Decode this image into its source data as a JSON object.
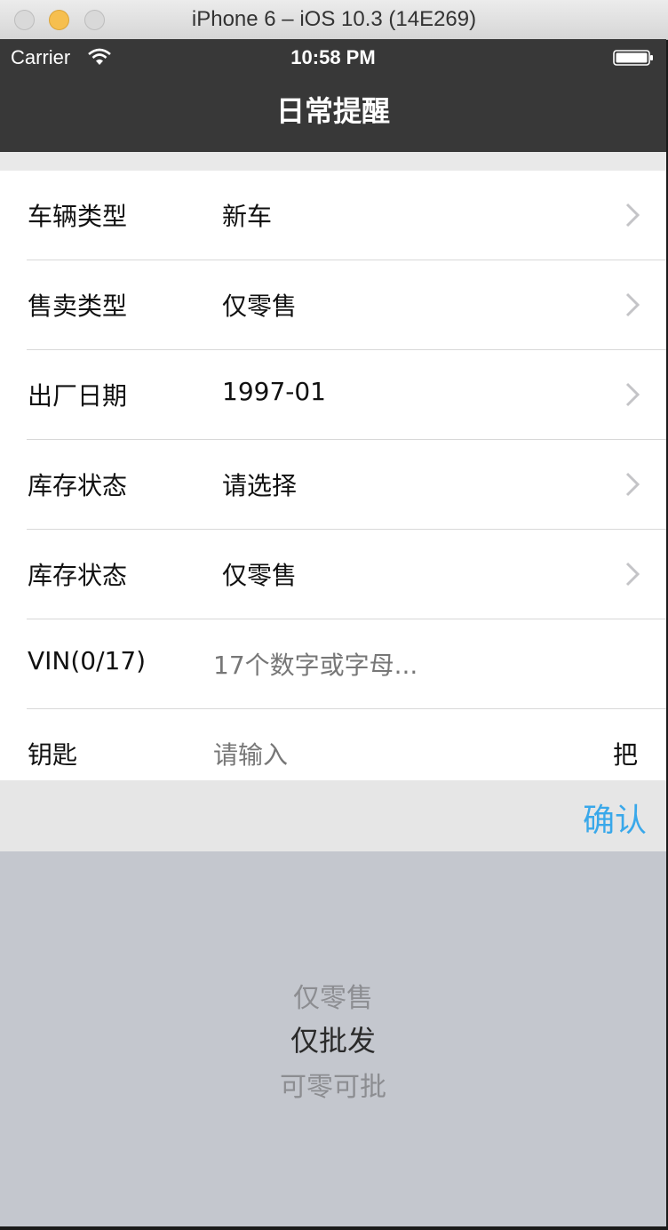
{
  "window": {
    "title": "iPhone 6 – iOS 10.3 (14E269)"
  },
  "status_bar": {
    "carrier": "Carrier",
    "time": "10:58 PM"
  },
  "nav": {
    "title": "日常提醒"
  },
  "form": {
    "rows": [
      {
        "label": "车辆类型",
        "value": "新车"
      },
      {
        "label": "售卖类型",
        "value": "仅零售"
      },
      {
        "label": "出厂日期",
        "value": "1997-01"
      },
      {
        "label": "库存状态",
        "value": "请选择"
      },
      {
        "label": "库存状态",
        "value": "仅零售"
      },
      {
        "label": "VIN(0/17)",
        "placeholder": "17个数字或字母..."
      },
      {
        "label": "钥匙",
        "placeholder": "请输入",
        "suffix": "把"
      }
    ]
  },
  "toolbar": {
    "confirm_label": "确认",
    "accent_color": "#39a8ea"
  },
  "picker": {
    "options": [
      "仅零售",
      "仅批发",
      "可零可批"
    ],
    "selected": "仅批发"
  }
}
